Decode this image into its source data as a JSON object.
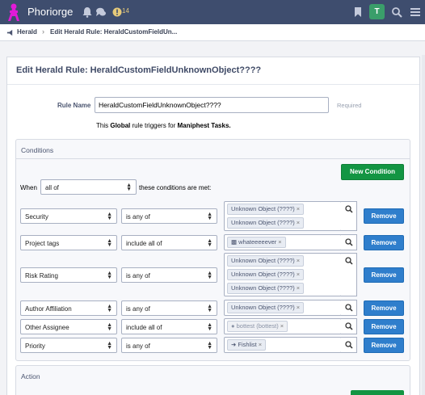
{
  "app": {
    "name": "Phoriorge",
    "notification_count": "14",
    "avatar_letter": "T"
  },
  "breadcrumb": {
    "items": [
      "Herald",
      "Edit Herald Rule: HeraldCustomFieldUn..."
    ]
  },
  "page": {
    "title": "Edit Herald Rule: HeraldCustomFieldUnknownObject????",
    "rule_name_label": "Rule Name",
    "rule_name_value": "HeraldCustomFieldUnknownObject????",
    "required_label": "Required",
    "triggers_prefix": "This",
    "triggers_scope": "Global",
    "triggers_middle": "rule triggers for",
    "triggers_object": "Maniphest Tasks."
  },
  "conditions": {
    "title": "Conditions",
    "new_condition_label": "New Condition",
    "when_label": "When",
    "match_value": "all of",
    "after_label": "these conditions are met:",
    "remove_label": "Remove",
    "rows": [
      {
        "field": "Security",
        "op": "is any of",
        "tokens": [
          {
            "label": "Unknown Object (????)",
            "x": "×"
          },
          {
            "label": "Unknown Object (????)",
            "x": "×"
          }
        ]
      },
      {
        "field": "Project tags",
        "op": "include all of",
        "tokens": [
          {
            "label": "whateeeeever",
            "x": "×"
          }
        ]
      },
      {
        "field": "Risk Rating",
        "op": "is any of",
        "tokens": [
          {
            "label": "Unknown Object (????)",
            "x": "×"
          },
          {
            "label": "Unknown Object (????)",
            "x": "×"
          },
          {
            "label": "Unknown Object (????)",
            "x": "×"
          }
        ]
      },
      {
        "field": "Author Affiliation",
        "op": "is any of",
        "tokens": [
          {
            "label": "Unknown Object (????)",
            "x": "×"
          }
        ]
      },
      {
        "field": "Other Assignee",
        "op": "include all of",
        "tokens": [
          {
            "label": "bottest (bottest)",
            "x": "×"
          }
        ]
      },
      {
        "field": "Priority",
        "op": "is any of",
        "tokens": [
          {
            "label": "Fishlist",
            "x": "×"
          }
        ]
      }
    ]
  },
  "action": {
    "title": "Action"
  },
  "colors": {
    "topbar": "#3e4d6e",
    "green": "#139543",
    "blue": "#2f7ecc",
    "logo": "#e21ad8"
  }
}
